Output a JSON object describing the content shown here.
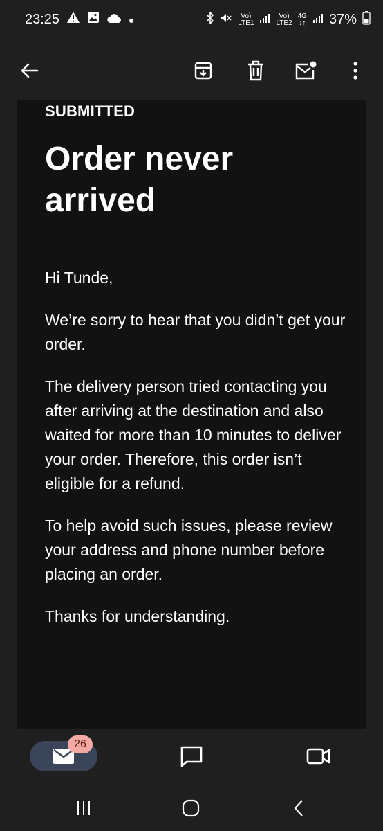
{
  "status_bar": {
    "time": "23:25",
    "sim1": "LTE1",
    "sim2": "LTE2",
    "net": "4G",
    "battery": "37%"
  },
  "email": {
    "status_label": "SUBMITTED",
    "title": "Order never arrived",
    "greeting": "Hi Tunde,",
    "paragraph1": "We’re sorry to hear that you didn’t get your order.",
    "paragraph2": "The delivery person tried contacting you after arriving at the destination and also waited for more than 10 minutes to deliver your order. Therefore, this order isn’t eligible for a refund.",
    "paragraph3": "To help avoid such issues, please review your address and phone number before placing an order.",
    "closing": "Thanks for understanding."
  },
  "bottom_nav": {
    "mail_badge": "26"
  },
  "colors": {
    "background": "#1f1f1f",
    "content": "#121212",
    "pill": "#3b4559",
    "badge": "#f4a9a2"
  }
}
